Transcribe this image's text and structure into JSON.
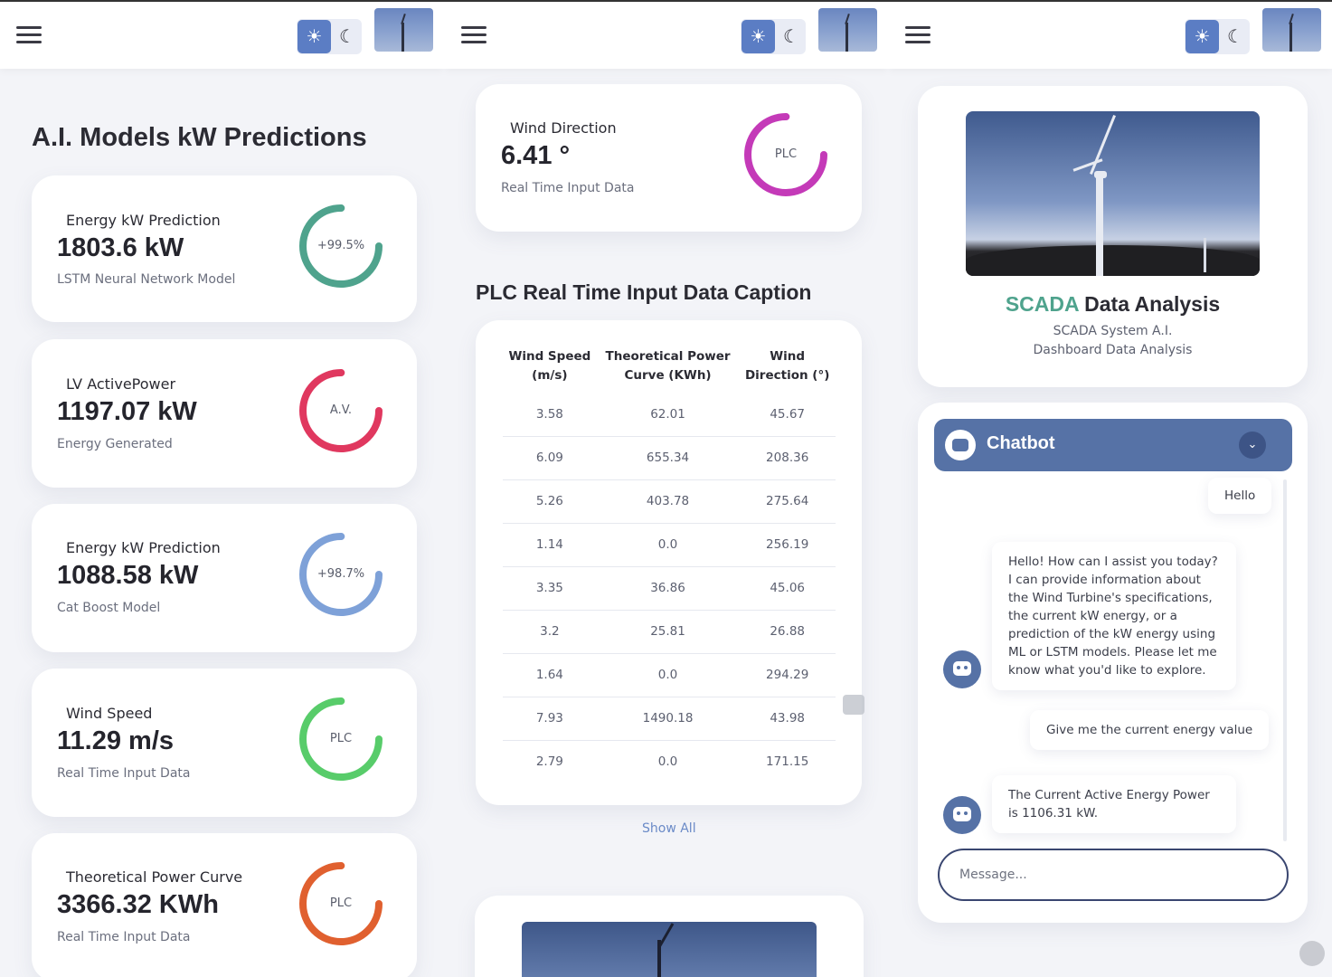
{
  "header": {
    "sun_glyph": "☀",
    "moon_glyph": "☾"
  },
  "column1": {
    "title": "A.I. Models kW Predictions",
    "cards": [
      {
        "label": "Energy kW Prediction",
        "value": "1803.6 kW",
        "sub": "LSTM Neural Network Model",
        "ring_text": "+99.5%",
        "ring_color": "#4fa38d",
        "ring_fraction": 0.75
      },
      {
        "label": "LV ActivePower",
        "value": "1197.07 kW",
        "sub": "Energy Generated",
        "ring_text": "A.V.",
        "ring_color": "#e0385f",
        "ring_fraction": 0.75
      },
      {
        "label": "Energy kW Prediction",
        "value": "1088.58 kW",
        "sub": "Cat Boost Model",
        "ring_text": "+98.7%",
        "ring_color": "#7ea1d8",
        "ring_fraction": 0.75
      },
      {
        "label": "Wind Speed",
        "value": "11.29 m/s",
        "sub": "Real Time Input Data",
        "ring_text": "PLC",
        "ring_color": "#58cc6a",
        "ring_fraction": 0.75
      },
      {
        "label": "Theoretical Power Curve",
        "value": "3366.32 KWh",
        "sub": "Real Time Input Data",
        "ring_text": "PLC",
        "ring_color": "#e0602f",
        "ring_fraction": 0.75
      }
    ]
  },
  "column2": {
    "wind_card": {
      "label": "Wind Direction",
      "value": "6.41 °",
      "sub": "Real Time Input Data",
      "ring_text": "PLC",
      "ring_color": "#c43ab8",
      "ring_fraction": 0.75
    },
    "table_title": "PLC Real Time Input Data Caption",
    "table": {
      "headers": [
        [
          "Wind Speed",
          "(m/s)"
        ],
        [
          "Theoretical Power",
          "Curve (KWh)"
        ],
        [
          "Wind",
          "Direction (°)"
        ]
      ],
      "rows": [
        [
          "3.58",
          "62.01",
          "45.67"
        ],
        [
          "6.09",
          "655.34",
          "208.36"
        ],
        [
          "5.26",
          "403.78",
          "275.64"
        ],
        [
          "1.14",
          "0.0",
          "256.19"
        ],
        [
          "3.35",
          "36.86",
          "45.06"
        ],
        [
          "3.2",
          "25.81",
          "26.88"
        ],
        [
          "1.64",
          "0.0",
          "294.29"
        ],
        [
          "7.93",
          "1490.18",
          "43.98"
        ],
        [
          "2.79",
          "0.0",
          "171.15"
        ]
      ]
    },
    "show_all": "Show All"
  },
  "column3": {
    "scada": {
      "title_accent": "SCADA",
      "title_rest": " Data Analysis",
      "line1": "SCADA System A.I.",
      "line2": "Dashboard Data Analysis"
    },
    "chatbot": {
      "title": "Chatbot",
      "user_hello": "Hello",
      "bot_reply1": "Hello! How can I assist you today? I can provide information about the Wind Turbine's specifications, the current kW energy, or a prediction of the kW energy using ML or LSTM models. Please let me know what you'd like to explore.",
      "user_msg2": "Give me the current energy value",
      "bot_reply2": "The Current Active Energy Power is 1106.31 kW.",
      "input_placeholder": "Message..."
    }
  },
  "colors": {
    "accent": "#5672a6",
    "scada_green": "#4fa38d",
    "show_all": "#6a8ac7"
  }
}
